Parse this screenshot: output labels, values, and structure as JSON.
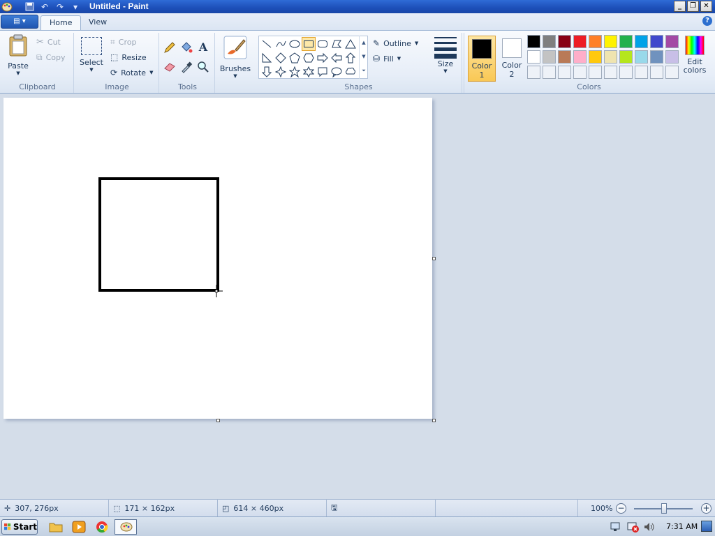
{
  "window": {
    "title": "Untitled - Paint"
  },
  "tabs": [
    {
      "label": "Home"
    },
    {
      "label": "View"
    }
  ],
  "clipboard": {
    "paste": "Paste",
    "cut": "Cut",
    "copy": "Copy",
    "label": "Clipboard"
  },
  "image": {
    "select": "Select",
    "crop": "Crop",
    "resize": "Resize",
    "rotate": "Rotate",
    "label": "Image"
  },
  "tools": {
    "label": "Tools",
    "text_tool_glyph": "A"
  },
  "brushes": {
    "label": "Brushes"
  },
  "shapes": {
    "outline": "Outline",
    "fill": "Fill",
    "label": "Shapes",
    "selected": "rectangle"
  },
  "size": {
    "label": "Size"
  },
  "colors": {
    "color1_label_a": "Color",
    "color1_label_b": "1",
    "color2_label_a": "Color",
    "color2_label_b": "2",
    "color1": "#000000",
    "color2": "#ffffff",
    "edit": "Edit colors",
    "label": "Colors",
    "palette_row1": [
      "#000000",
      "#7f7f7f",
      "#880015",
      "#ed1c24",
      "#ff7f27",
      "#fff200",
      "#22b14c",
      "#00a2e8",
      "#3f48cc",
      "#a349a4"
    ],
    "palette_row2": [
      "#ffffff",
      "#c3c3c3",
      "#b97a57",
      "#ffaec9",
      "#ffc90e",
      "#efe4b0",
      "#b5e61d",
      "#99d9ea",
      "#7092be",
      "#c8bfe7"
    ]
  },
  "status": {
    "cursor_pos": "307, 276px",
    "selection_size": "171 × 162px",
    "canvas_size": "614 × 460px",
    "zoom": "100%"
  },
  "taskbar": {
    "start": "Start",
    "clock": "7:31 AM"
  }
}
